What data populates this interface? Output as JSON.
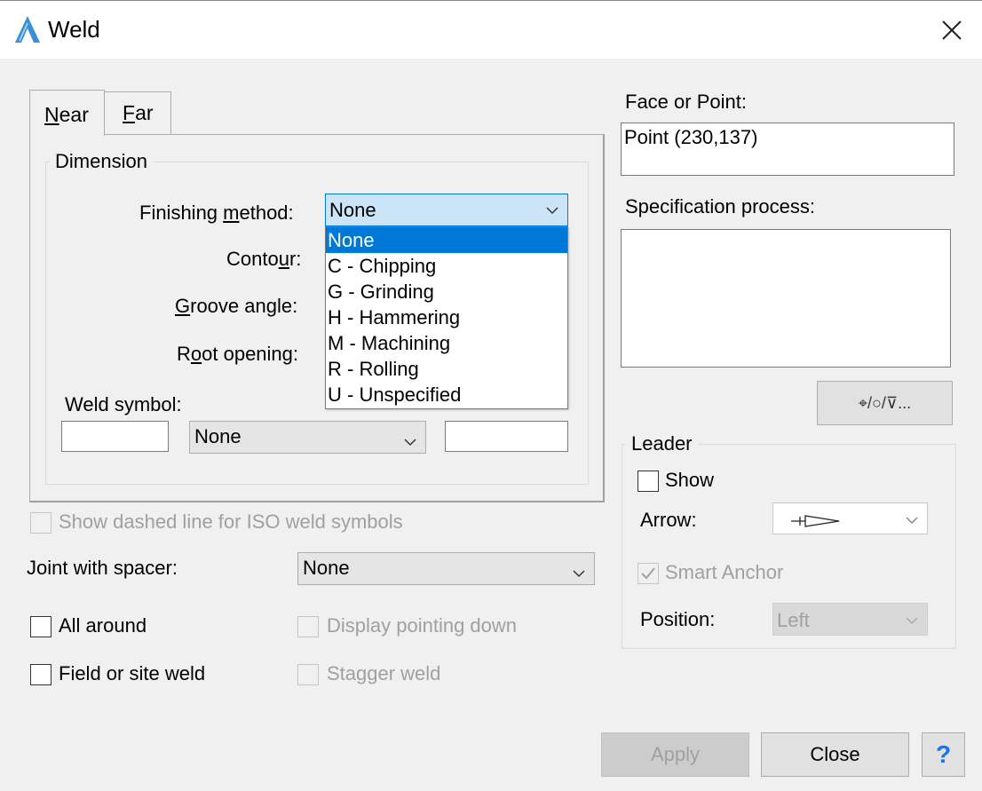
{
  "window": {
    "title": "Weld"
  },
  "tabs": [
    {
      "label_pre": "",
      "mnemonic": "N",
      "label_post": "ear",
      "active": true
    },
    {
      "label_pre": "",
      "mnemonic": "F",
      "label_post": "ar",
      "active": false
    }
  ],
  "dimension": {
    "group_title": "Dimension",
    "finishing_method": {
      "label_pre": "Finishing ",
      "mnemonic": "m",
      "label_post": "ethod:",
      "value": "None"
    },
    "contour": {
      "label_pre": "Conto",
      "mnemonic": "u",
      "label_post": "r:"
    },
    "groove_angle": {
      "label_pre": "",
      "mnemonic": "G",
      "label_post": "roove angle:"
    },
    "root_opening": {
      "label_pre": "R",
      "mnemonic": "o",
      "label_post": "ot opening:"
    },
    "weld_symbol": {
      "label": "Weld symbol:",
      "left_value": "",
      "combo_value": "None",
      "right_value": ""
    }
  },
  "finishing_dropdown": {
    "options": [
      "None",
      "C - Chipping",
      "G - Grinding",
      "H - Hammering",
      "M - Machining",
      "R - Rolling",
      "U - Unspecified"
    ],
    "selected_index": 0
  },
  "iso_dashed": {
    "label": "Show dashed line for ISO weld symbols",
    "checked": false,
    "enabled": false
  },
  "joint_spacer": {
    "label": "Joint with spacer:",
    "value": "None"
  },
  "all_around": {
    "label": "All around",
    "checked": false
  },
  "field_weld": {
    "label": "Field or site weld",
    "checked": false
  },
  "pointing_down": {
    "label": "Display pointing down",
    "checked": false,
    "enabled": false
  },
  "stagger": {
    "label": "Stagger weld",
    "checked": false,
    "enabled": false
  },
  "face_point": {
    "label": "Face or Point:",
    "value": "Point (230,137)"
  },
  "spec_process": {
    "label": "Specification process:",
    "value": ""
  },
  "symbols_button": {
    "label": "⌖/○/⊽..."
  },
  "leader": {
    "group_title": "Leader",
    "show": {
      "label": "Show",
      "checked": false
    },
    "arrow": {
      "label": "Arrow:"
    },
    "smart_anchor": {
      "label": "Smart Anchor",
      "checked": true,
      "enabled": false
    },
    "position": {
      "label": "Position:",
      "value": "Left"
    }
  },
  "buttons": {
    "apply": "Apply",
    "close": "Close",
    "help": "?"
  },
  "colors": {
    "accent": "#0078d7",
    "help_blue": "#1a73e8",
    "logo": "#3a8fd6"
  }
}
